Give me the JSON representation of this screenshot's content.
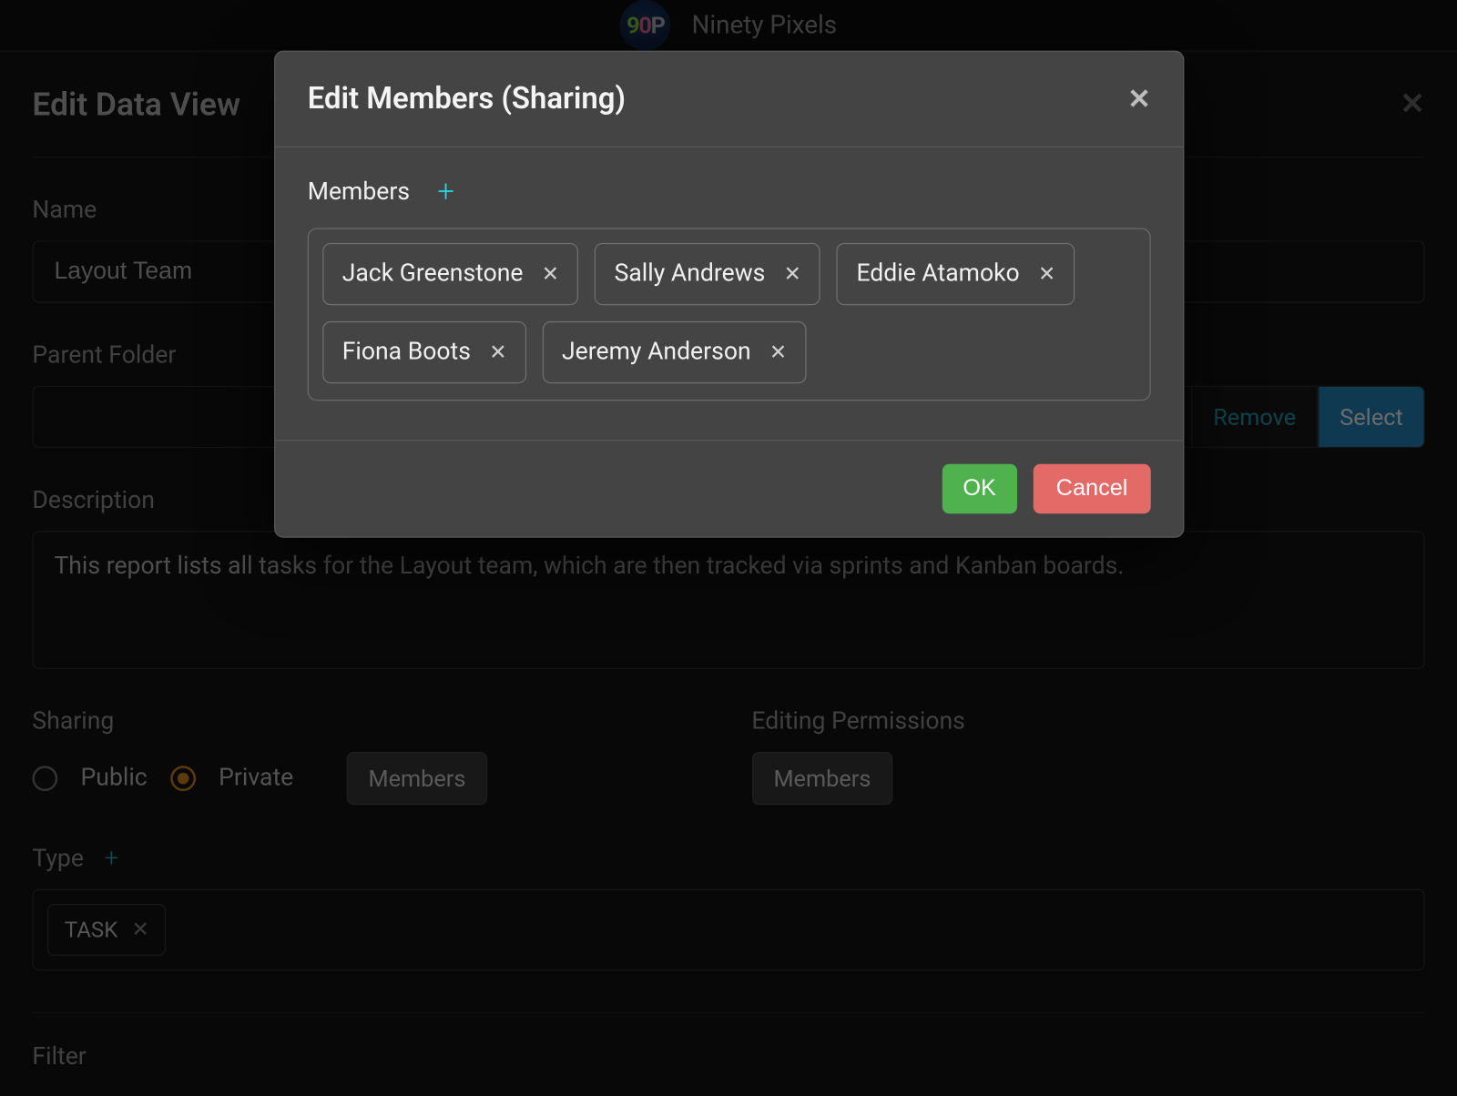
{
  "app": {
    "logo_text_1": "9",
    "logo_text_2": "0",
    "logo_text_3": "P",
    "name": "Ninety Pixels"
  },
  "bg_panel": {
    "title": "Edit Data View",
    "name_label": "Name",
    "name_value": "Layout Team",
    "parent_folder_label": "Parent Folder",
    "parent_folder_value": "",
    "remove_label": "Remove",
    "select_label": "Select",
    "description_label": "Description",
    "description_value": "This report lists all tasks for the Layout team, which are then tracked via sprints and Kanban boards.",
    "sharing_label": "Sharing",
    "public_label": "Public",
    "private_label": "Private",
    "sharing_members_btn": "Members",
    "editing_perm_label": "Editing Permissions",
    "editing_members_btn": "Members",
    "type_label": "Type",
    "type_chips": [
      {
        "label": "TASK"
      }
    ],
    "filter_label": "Filter"
  },
  "modal": {
    "title": "Edit Members (Sharing)",
    "members_label": "Members",
    "members": [
      {
        "name": "Jack Greenstone"
      },
      {
        "name": "Sally Andrews"
      },
      {
        "name": "Eddie Atamoko"
      },
      {
        "name": "Fiona Boots"
      },
      {
        "name": "Jeremy Anderson"
      }
    ],
    "ok_label": "OK",
    "cancel_label": "Cancel"
  }
}
